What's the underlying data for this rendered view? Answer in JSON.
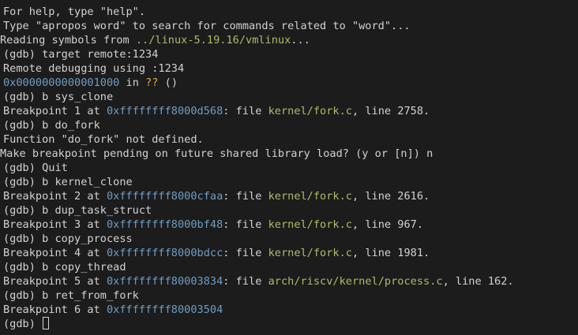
{
  "terminal": {
    "lines": [
      {
        "segments": [
          {
            "text": "For help, type \"help\"."
          }
        ]
      },
      {
        "segments": [
          {
            "text": "Type \"apropos word\" to search for commands related to \"word\"..."
          }
        ]
      },
      {
        "edge": true,
        "segments": [
          {
            "text": "Reading symbols from "
          },
          {
            "text": "../linux-5.19.16/vmlinux",
            "kind": "file"
          },
          {
            "text": "..."
          }
        ]
      },
      {
        "segments": [
          {
            "text": "(gdb) target remote:1234"
          }
        ]
      },
      {
        "segments": [
          {
            "text": "Remote debugging using :1234"
          }
        ]
      },
      {
        "segments": [
          {
            "text": "0x0000000000001000",
            "kind": "addr"
          },
          {
            "text": " in "
          },
          {
            "text": "??",
            "kind": "unk"
          },
          {
            "text": " ()"
          }
        ]
      },
      {
        "segments": [
          {
            "text": "(gdb) b sys_clone"
          }
        ]
      },
      {
        "segments": [
          {
            "text": "Breakpoint 1 at "
          },
          {
            "text": "0xffffffff8000d568",
            "kind": "addr"
          },
          {
            "text": ": file "
          },
          {
            "text": "kernel/fork.c",
            "kind": "file"
          },
          {
            "text": ", line 2758."
          }
        ]
      },
      {
        "segments": [
          {
            "text": "(gdb) b do_fork"
          }
        ]
      },
      {
        "segments": [
          {
            "text": "Function \"do_fork\" not defined."
          }
        ]
      },
      {
        "edge": true,
        "segments": [
          {
            "text": "Make breakpoint pending on future shared library load? (y or [n]) n"
          }
        ]
      },
      {
        "segments": [
          {
            "text": "(gdb) Quit"
          }
        ]
      },
      {
        "segments": [
          {
            "text": "(gdb) b kernel_clone"
          }
        ]
      },
      {
        "segments": [
          {
            "text": "Breakpoint 2 at "
          },
          {
            "text": "0xffffffff8000cfaa",
            "kind": "addr"
          },
          {
            "text": ": file "
          },
          {
            "text": "kernel/fork.c",
            "kind": "file"
          },
          {
            "text": ", line 2616."
          }
        ]
      },
      {
        "segments": [
          {
            "text": "(gdb) b dup_task_struct"
          }
        ]
      },
      {
        "segments": [
          {
            "text": "Breakpoint 3 at "
          },
          {
            "text": "0xffffffff8000bf48",
            "kind": "addr"
          },
          {
            "text": ": file "
          },
          {
            "text": "kernel/fork.c",
            "kind": "file"
          },
          {
            "text": ", line 967."
          }
        ]
      },
      {
        "segments": [
          {
            "text": "(gdb) b copy_process"
          }
        ]
      },
      {
        "segments": [
          {
            "text": "Breakpoint 4 at "
          },
          {
            "text": "0xffffffff8000bdcc",
            "kind": "addr"
          },
          {
            "text": ": file "
          },
          {
            "text": "kernel/fork.c",
            "kind": "file"
          },
          {
            "text": ", line 1981."
          }
        ]
      },
      {
        "segments": [
          {
            "text": "(gdb) b copy_thread"
          }
        ]
      },
      {
        "segments": [
          {
            "text": "Breakpoint 5 at "
          },
          {
            "text": "0xffffffff80003834",
            "kind": "addr"
          },
          {
            "text": ": file "
          },
          {
            "text": "arch/riscv/kernel/process.c",
            "kind": "file"
          },
          {
            "text": ", line 162."
          }
        ]
      },
      {
        "segments": [
          {
            "text": "(gdb) b ret_from_fork"
          }
        ]
      },
      {
        "segments": [
          {
            "text": "Breakpoint 6 at "
          },
          {
            "text": "0xffffffff80003504",
            "kind": "addr"
          }
        ]
      }
    ],
    "prompt": "(gdb) "
  },
  "colors": {
    "background": "#1c1c1c",
    "text": "#d2d2d2",
    "address": "#6f9dc4",
    "file": "#b1b96a",
    "unknown": "#d6ad3c"
  }
}
